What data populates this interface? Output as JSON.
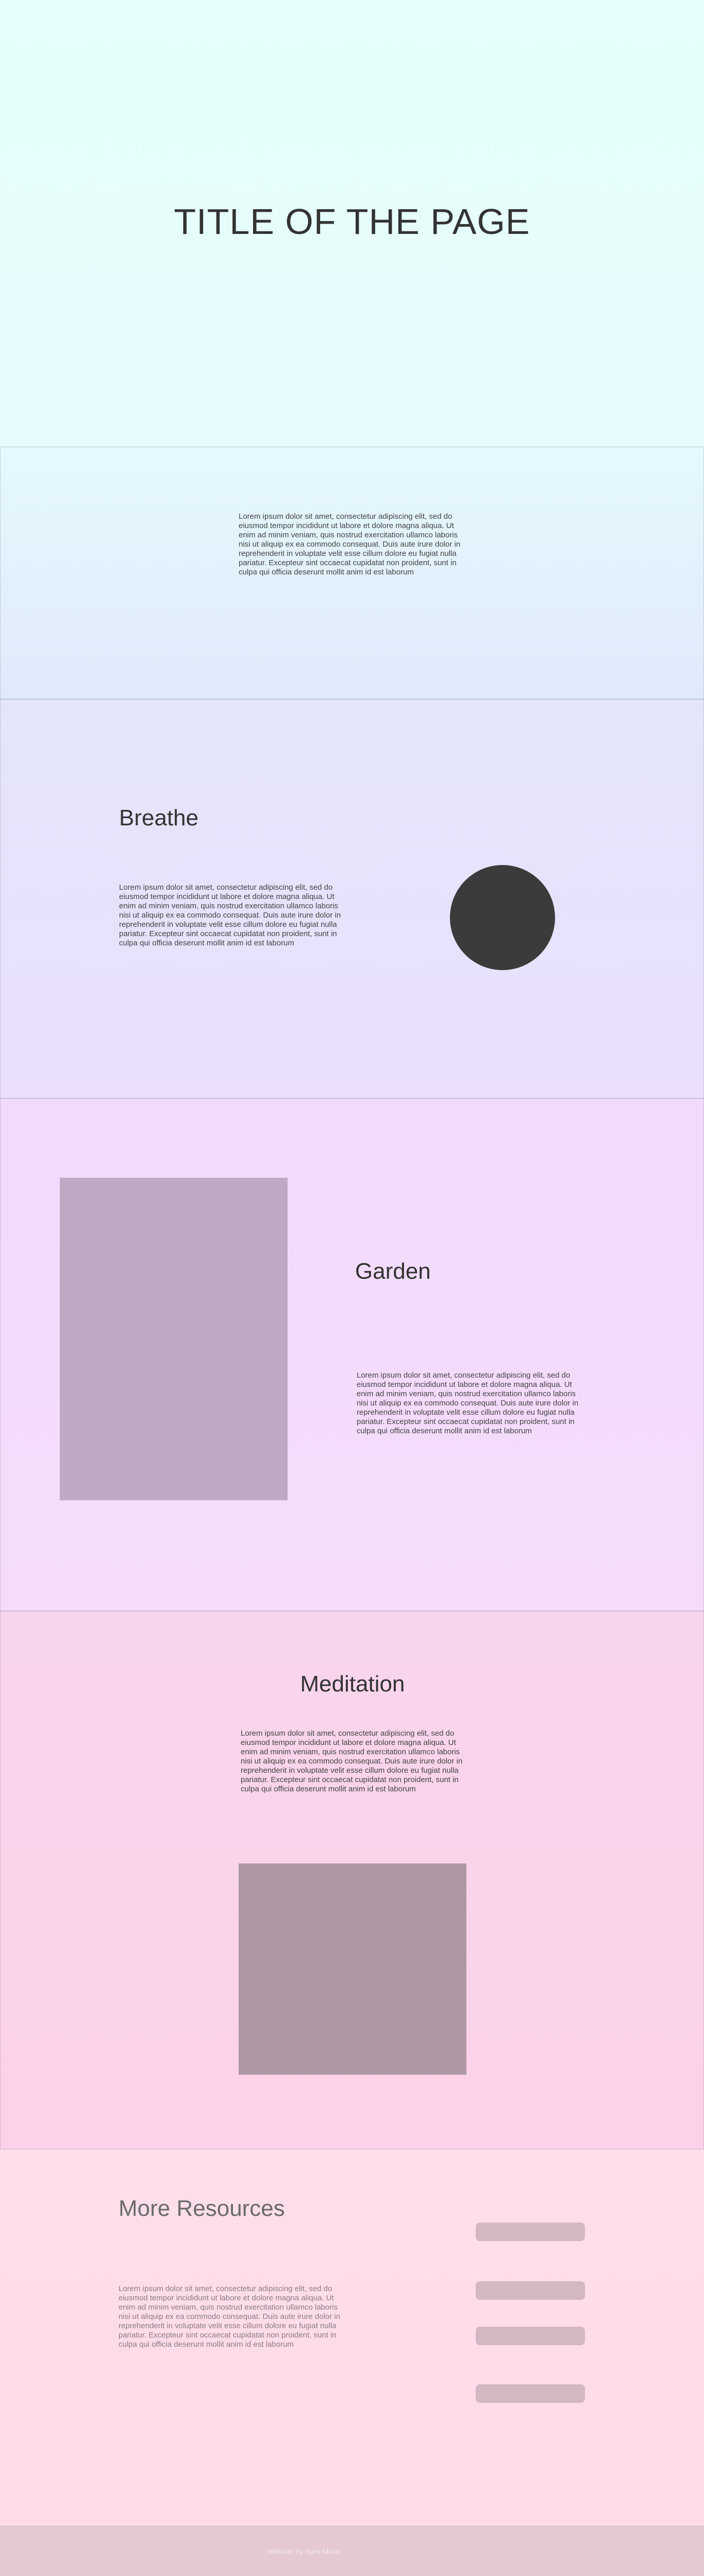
{
  "hero": {
    "title": "TITLE OF THE PAGE"
  },
  "intro": {
    "text": "Lorem ipsum dolor sit amet, consectetur adipiscing elit, sed do eiusmod tempor incididunt ut labore et dolore magna aliqua. Ut enim ad minim veniam, quis nostrud exercitation ullamco laboris nisi ut aliquip ex ea commodo consequat. Duis aute irure dolor in reprehenderit in voluptate velit esse cillum dolore eu fugiat nulla pariatur. Excepteur sint occaecat cupidatat non proident, sunt in culpa qui officia deserunt mollit anim id est laborum"
  },
  "breathe": {
    "title": "Breathe",
    "text": "Lorem ipsum dolor sit amet, consectetur adipiscing elit, sed do eiusmod tempor incididunt ut labore et dolore magna aliqua. Ut enim ad minim veniam, quis nostrud exercitation ullamco laboris nisi ut aliquip ex ea commodo consequat. Duis aute irure dolor in reprehenderit in voluptate velit esse cillum dolore eu fugiat nulla pariatur. Excepteur sint occaecat cupidatat non proident, sunt in culpa qui officia deserunt mollit anim id est laborum"
  },
  "garden": {
    "title": "Garden",
    "text": "Lorem ipsum dolor sit amet, consectetur adipiscing elit, sed do eiusmod tempor incididunt ut labore et dolore magna aliqua. Ut enim ad minim veniam, quis nostrud exercitation ullamco laboris nisi ut aliquip ex ea commodo consequat. Duis aute irure dolor in reprehenderit in voluptate velit esse cillum dolore eu fugiat nulla pariatur. Excepteur sint occaecat cupidatat non proident, sunt in culpa qui officia deserunt mollit anim id est laborum"
  },
  "meditation": {
    "title": "Meditation",
    "text": "Lorem ipsum dolor sit amet, consectetur adipiscing elit, sed do eiusmod tempor incididunt ut labore et dolore magna aliqua. Ut enim ad minim veniam, quis nostrud exercitation ullamco laboris nisi ut aliquip ex ea commodo consequat. Duis aute irure dolor in reprehenderit in voluptate velit esse cillum dolore eu fugiat nulla pariatur. Excepteur sint occaecat cupidatat non proident, sunt in culpa qui officia deserunt mollit anim id est laborum"
  },
  "resources": {
    "title": "More Resources",
    "text": "Lorem ipsum dolor sit amet, consectetur adipiscing elit, sed do eiusmod tempor incididunt ut labore et dolore magna aliqua. Ut enim ad minim veniam, quis nostrud exercitation ullamco laboris nisi ut aliquip ex ea commodo consequat. Duis aute irure dolor in reprehenderit in voluptate velit esse cillum dolore eu fugiat nulla pariatur. Excepteur sint occaecat cupidatat non proident, sunt in culpa qui officia deserunt mollit anim id est laborum"
  },
  "footer": {
    "credit": "Website by Sara Marie",
    "credit_sub": "———————————————"
  },
  "colors": {
    "circle": "#3b3b3b",
    "garden_image": "#bea8c3",
    "meditation_image": "#ae98a3",
    "resource_pill": "#d3b7c2",
    "footer": "#e4c9d2"
  }
}
